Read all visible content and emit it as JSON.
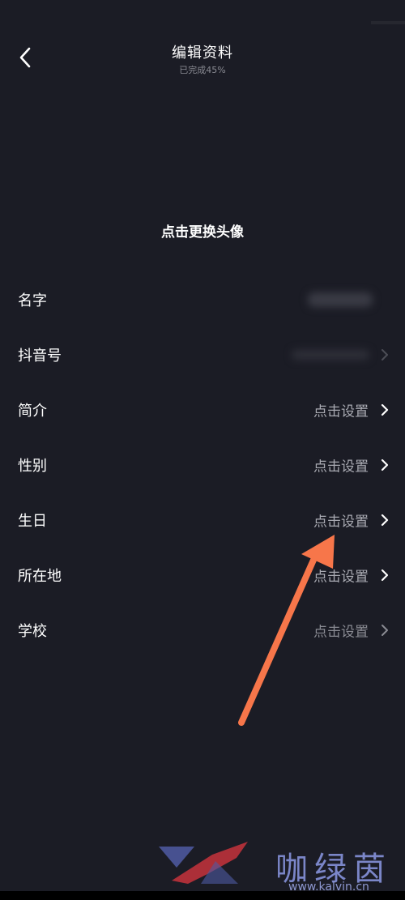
{
  "header": {
    "title": "编辑资料",
    "subtitle": "已完成45%"
  },
  "avatar": {
    "change_label": "点击更换头像"
  },
  "rows": [
    {
      "label": "名字",
      "value": ""
    },
    {
      "label": "抖音号",
      "value": ""
    },
    {
      "label": "简介",
      "value": "点击设置"
    },
    {
      "label": "性别",
      "value": "点击设置"
    },
    {
      "label": "生日",
      "value": "点击设置"
    },
    {
      "label": "所在地",
      "value": "点击设置"
    },
    {
      "label": "学校",
      "value": "点击设置"
    }
  ],
  "annotation": {
    "color": "#f7764a"
  },
  "watermark": {
    "text": "咖绿茵",
    "url": "www.kalvin.cn"
  },
  "colors": {
    "background": "#1b1c25",
    "text_primary": "#ffffff",
    "text_secondary": "#a9aab2"
  }
}
